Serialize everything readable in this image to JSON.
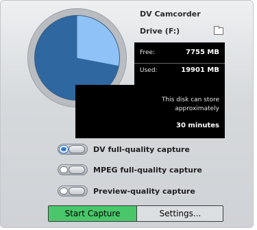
{
  "device": {
    "name": "DV Camcorder"
  },
  "drive": {
    "label": "Drive (F:)",
    "icon": "folder-icon"
  },
  "stats": {
    "free_label": "Free:",
    "free_value": "7755 MB",
    "used_label": "Used:",
    "used_value": "19901 MB"
  },
  "disk_usage": {
    "free_fraction": 0.28,
    "used_fraction": 0.72
  },
  "store": {
    "line1": "This disk can store",
    "line2": "approximately",
    "duration": "30 minutes"
  },
  "options": [
    {
      "label": "DV full-quality capture",
      "selected": true
    },
    {
      "label": "MPEG full-quality capture",
      "selected": false
    },
    {
      "label": "Preview-quality capture",
      "selected": false
    }
  ],
  "buttons": {
    "start_label": "Start Capture",
    "settings_label": "Settings..."
  },
  "colors": {
    "pie_used": "#2f67a0",
    "pie_free": "#8fc3f7",
    "start_green": "#49c76a",
    "selection_blue": "#2f7ad8"
  }
}
